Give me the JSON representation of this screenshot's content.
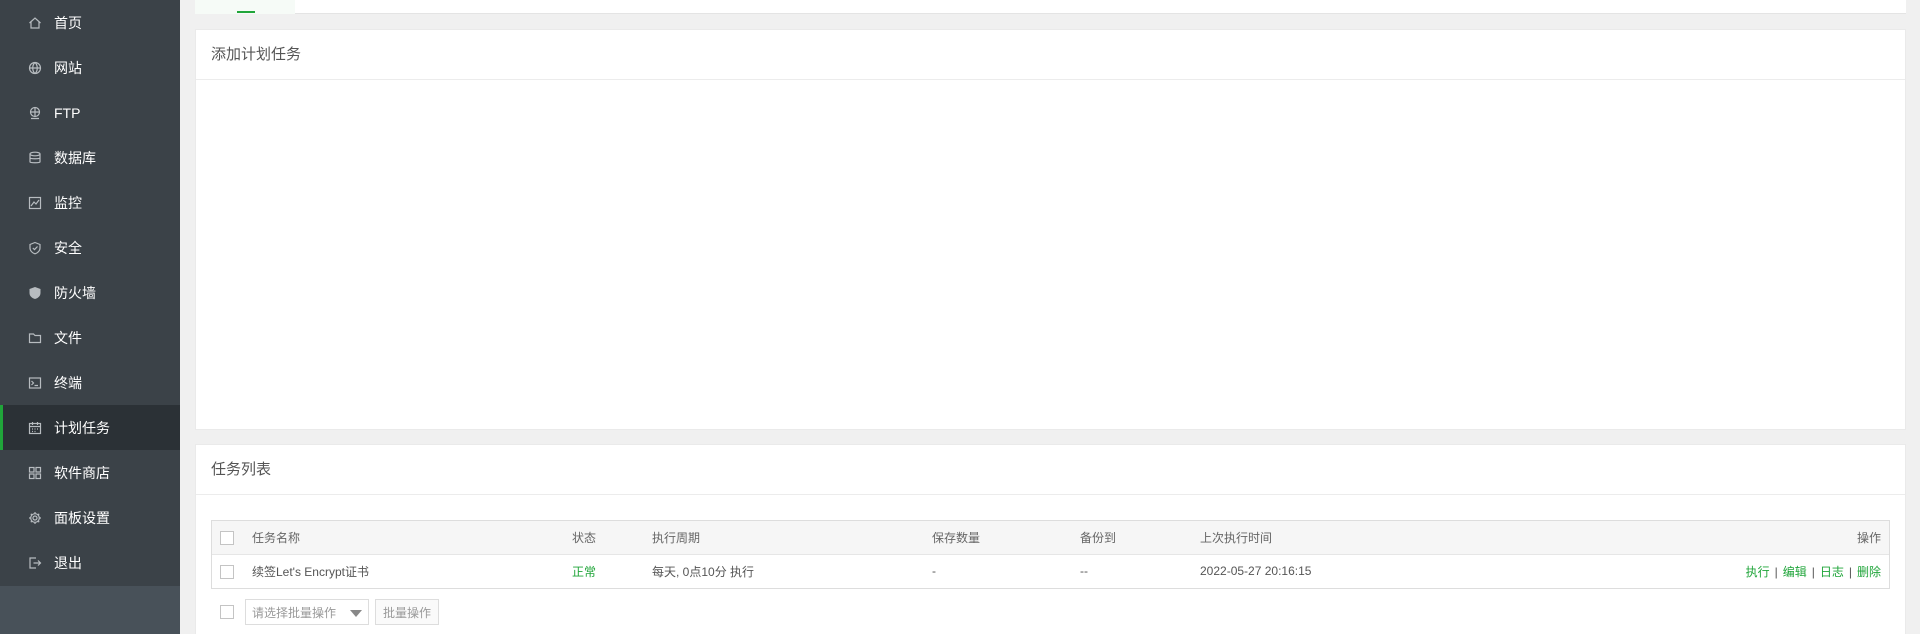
{
  "sidebar": {
    "items": [
      {
        "label": "首页",
        "icon": "home-icon"
      },
      {
        "label": "网站",
        "icon": "globe-icon"
      },
      {
        "label": "FTP",
        "icon": "ftp-icon"
      },
      {
        "label": "数据库",
        "icon": "database-icon"
      },
      {
        "label": "监控",
        "icon": "monitor-icon"
      },
      {
        "label": "安全",
        "icon": "shield-icon"
      },
      {
        "label": "防火墙",
        "icon": "firewall-icon"
      },
      {
        "label": "文件",
        "icon": "folder-icon"
      },
      {
        "label": "终端",
        "icon": "terminal-icon"
      },
      {
        "label": "计划任务",
        "icon": "calendar-icon",
        "active": true
      },
      {
        "label": "软件商店",
        "icon": "grid-icon"
      },
      {
        "label": "面板设置",
        "icon": "gear-icon"
      },
      {
        "label": "退出",
        "icon": "logout-icon"
      }
    ]
  },
  "add_panel": {
    "title": "添加计划任务"
  },
  "task_list": {
    "title": "任务列表",
    "columns": [
      "任务名称",
      "状态",
      "执行周期",
      "保存数量",
      "备份到",
      "上次执行时间",
      "操作"
    ],
    "rows": [
      {
        "name": "续签Let's Encrypt证书",
        "status": "正常",
        "cycle": "每天, 0点10分 执行",
        "keep": "-",
        "backup_to": "--",
        "last_run": "2022-05-27 20:16:15",
        "actions": [
          "执行",
          "编辑",
          "日志",
          "删除"
        ]
      }
    ],
    "batch_placeholder": "请选择批量操作",
    "batch_button": "批量操作"
  },
  "colors": {
    "accent": "#20a53a",
    "sidebar_bg": "#3b4248"
  }
}
